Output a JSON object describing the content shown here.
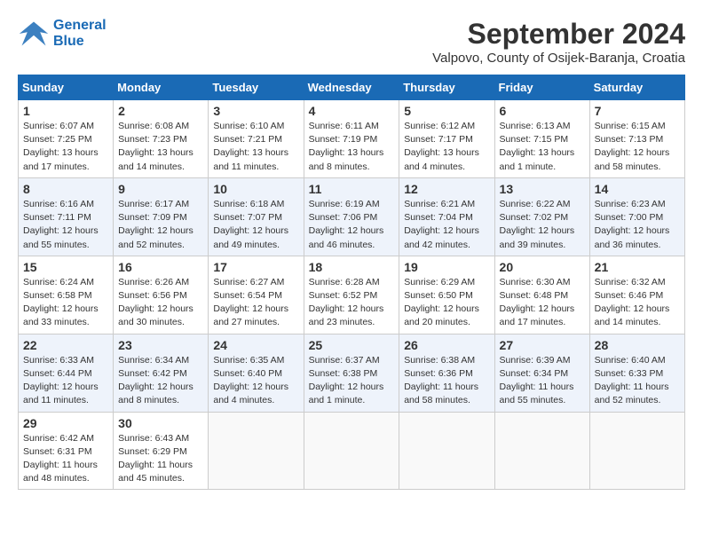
{
  "header": {
    "logo_line1": "General",
    "logo_line2": "Blue",
    "month_year": "September 2024",
    "location": "Valpovo, County of Osijek-Baranja, Croatia"
  },
  "days_of_week": [
    "Sunday",
    "Monday",
    "Tuesday",
    "Wednesday",
    "Thursday",
    "Friday",
    "Saturday"
  ],
  "weeks": [
    [
      {
        "day": "1",
        "info": "Sunrise: 6:07 AM\nSunset: 7:25 PM\nDaylight: 13 hours and 17 minutes."
      },
      {
        "day": "2",
        "info": "Sunrise: 6:08 AM\nSunset: 7:23 PM\nDaylight: 13 hours and 14 minutes."
      },
      {
        "day": "3",
        "info": "Sunrise: 6:10 AM\nSunset: 7:21 PM\nDaylight: 13 hours and 11 minutes."
      },
      {
        "day": "4",
        "info": "Sunrise: 6:11 AM\nSunset: 7:19 PM\nDaylight: 13 hours and 8 minutes."
      },
      {
        "day": "5",
        "info": "Sunrise: 6:12 AM\nSunset: 7:17 PM\nDaylight: 13 hours and 4 minutes."
      },
      {
        "day": "6",
        "info": "Sunrise: 6:13 AM\nSunset: 7:15 PM\nDaylight: 13 hours and 1 minute."
      },
      {
        "day": "7",
        "info": "Sunrise: 6:15 AM\nSunset: 7:13 PM\nDaylight: 12 hours and 58 minutes."
      }
    ],
    [
      {
        "day": "8",
        "info": "Sunrise: 6:16 AM\nSunset: 7:11 PM\nDaylight: 12 hours and 55 minutes."
      },
      {
        "day": "9",
        "info": "Sunrise: 6:17 AM\nSunset: 7:09 PM\nDaylight: 12 hours and 52 minutes."
      },
      {
        "day": "10",
        "info": "Sunrise: 6:18 AM\nSunset: 7:07 PM\nDaylight: 12 hours and 49 minutes."
      },
      {
        "day": "11",
        "info": "Sunrise: 6:19 AM\nSunset: 7:06 PM\nDaylight: 12 hours and 46 minutes."
      },
      {
        "day": "12",
        "info": "Sunrise: 6:21 AM\nSunset: 7:04 PM\nDaylight: 12 hours and 42 minutes."
      },
      {
        "day": "13",
        "info": "Sunrise: 6:22 AM\nSunset: 7:02 PM\nDaylight: 12 hours and 39 minutes."
      },
      {
        "day": "14",
        "info": "Sunrise: 6:23 AM\nSunset: 7:00 PM\nDaylight: 12 hours and 36 minutes."
      }
    ],
    [
      {
        "day": "15",
        "info": "Sunrise: 6:24 AM\nSunset: 6:58 PM\nDaylight: 12 hours and 33 minutes."
      },
      {
        "day": "16",
        "info": "Sunrise: 6:26 AM\nSunset: 6:56 PM\nDaylight: 12 hours and 30 minutes."
      },
      {
        "day": "17",
        "info": "Sunrise: 6:27 AM\nSunset: 6:54 PM\nDaylight: 12 hours and 27 minutes."
      },
      {
        "day": "18",
        "info": "Sunrise: 6:28 AM\nSunset: 6:52 PM\nDaylight: 12 hours and 23 minutes."
      },
      {
        "day": "19",
        "info": "Sunrise: 6:29 AM\nSunset: 6:50 PM\nDaylight: 12 hours and 20 minutes."
      },
      {
        "day": "20",
        "info": "Sunrise: 6:30 AM\nSunset: 6:48 PM\nDaylight: 12 hours and 17 minutes."
      },
      {
        "day": "21",
        "info": "Sunrise: 6:32 AM\nSunset: 6:46 PM\nDaylight: 12 hours and 14 minutes."
      }
    ],
    [
      {
        "day": "22",
        "info": "Sunrise: 6:33 AM\nSunset: 6:44 PM\nDaylight: 12 hours and 11 minutes."
      },
      {
        "day": "23",
        "info": "Sunrise: 6:34 AM\nSunset: 6:42 PM\nDaylight: 12 hours and 8 minutes."
      },
      {
        "day": "24",
        "info": "Sunrise: 6:35 AM\nSunset: 6:40 PM\nDaylight: 12 hours and 4 minutes."
      },
      {
        "day": "25",
        "info": "Sunrise: 6:37 AM\nSunset: 6:38 PM\nDaylight: 12 hours and 1 minute."
      },
      {
        "day": "26",
        "info": "Sunrise: 6:38 AM\nSunset: 6:36 PM\nDaylight: 11 hours and 58 minutes."
      },
      {
        "day": "27",
        "info": "Sunrise: 6:39 AM\nSunset: 6:34 PM\nDaylight: 11 hours and 55 minutes."
      },
      {
        "day": "28",
        "info": "Sunrise: 6:40 AM\nSunset: 6:33 PM\nDaylight: 11 hours and 52 minutes."
      }
    ],
    [
      {
        "day": "29",
        "info": "Sunrise: 6:42 AM\nSunset: 6:31 PM\nDaylight: 11 hours and 48 minutes."
      },
      {
        "day": "30",
        "info": "Sunrise: 6:43 AM\nSunset: 6:29 PM\nDaylight: 11 hours and 45 minutes."
      },
      {
        "day": "",
        "info": ""
      },
      {
        "day": "",
        "info": ""
      },
      {
        "day": "",
        "info": ""
      },
      {
        "day": "",
        "info": ""
      },
      {
        "day": "",
        "info": ""
      }
    ]
  ]
}
